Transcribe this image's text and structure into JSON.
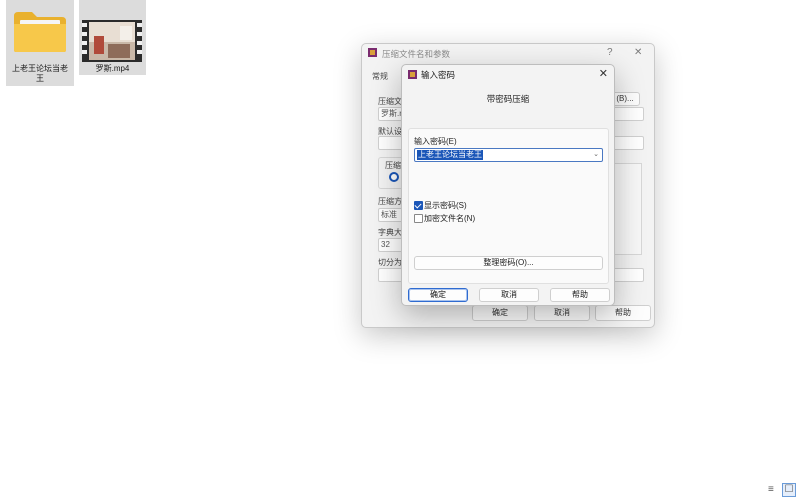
{
  "desktop": {
    "files": [
      {
        "name_line1": "上老王论坛当老",
        "name_line2": "王",
        "type": "folder"
      },
      {
        "name_line1": "罗斯.mp4",
        "type": "video"
      }
    ]
  },
  "bg_dialog": {
    "title": "压缩文件名和参数",
    "help_symbol": "?",
    "close_symbol": "✕",
    "tab_general": "常规",
    "archive_name_label": "压缩文",
    "archive_name_value": "罗斯.r",
    "browse_button": "(B)...",
    "default_settings_label": "默认设",
    "format_label": "压缩文",
    "method_label": "压缩方",
    "method_value": "标准",
    "dict_label": "字典大",
    "dict_value": "32",
    "split_label": "切分为",
    "ok_button": "确定",
    "cancel_button": "取消",
    "help_button": "帮助"
  },
  "password_dialog": {
    "title": "输入密码",
    "close_symbol": "✕",
    "heading": "带密码压缩",
    "password_label": "输入密码(E)",
    "password_value": "上老王论坛当老王",
    "show_password_label": "显示密码(S)",
    "show_password_checked": true,
    "encrypt_names_label": "加密文件名(N)",
    "encrypt_names_checked": false,
    "organize_button": "整理密码(O)...",
    "ok_button": "确定",
    "cancel_button": "取消",
    "help_button": "帮助"
  },
  "taskbar": {
    "list_view_icon": "≡",
    "details_view_icon": "☐"
  },
  "colors": {
    "accent": "#1a56b8",
    "dialog_bg": "#f3f3f3",
    "selection_bg": "#dcdcdc"
  }
}
